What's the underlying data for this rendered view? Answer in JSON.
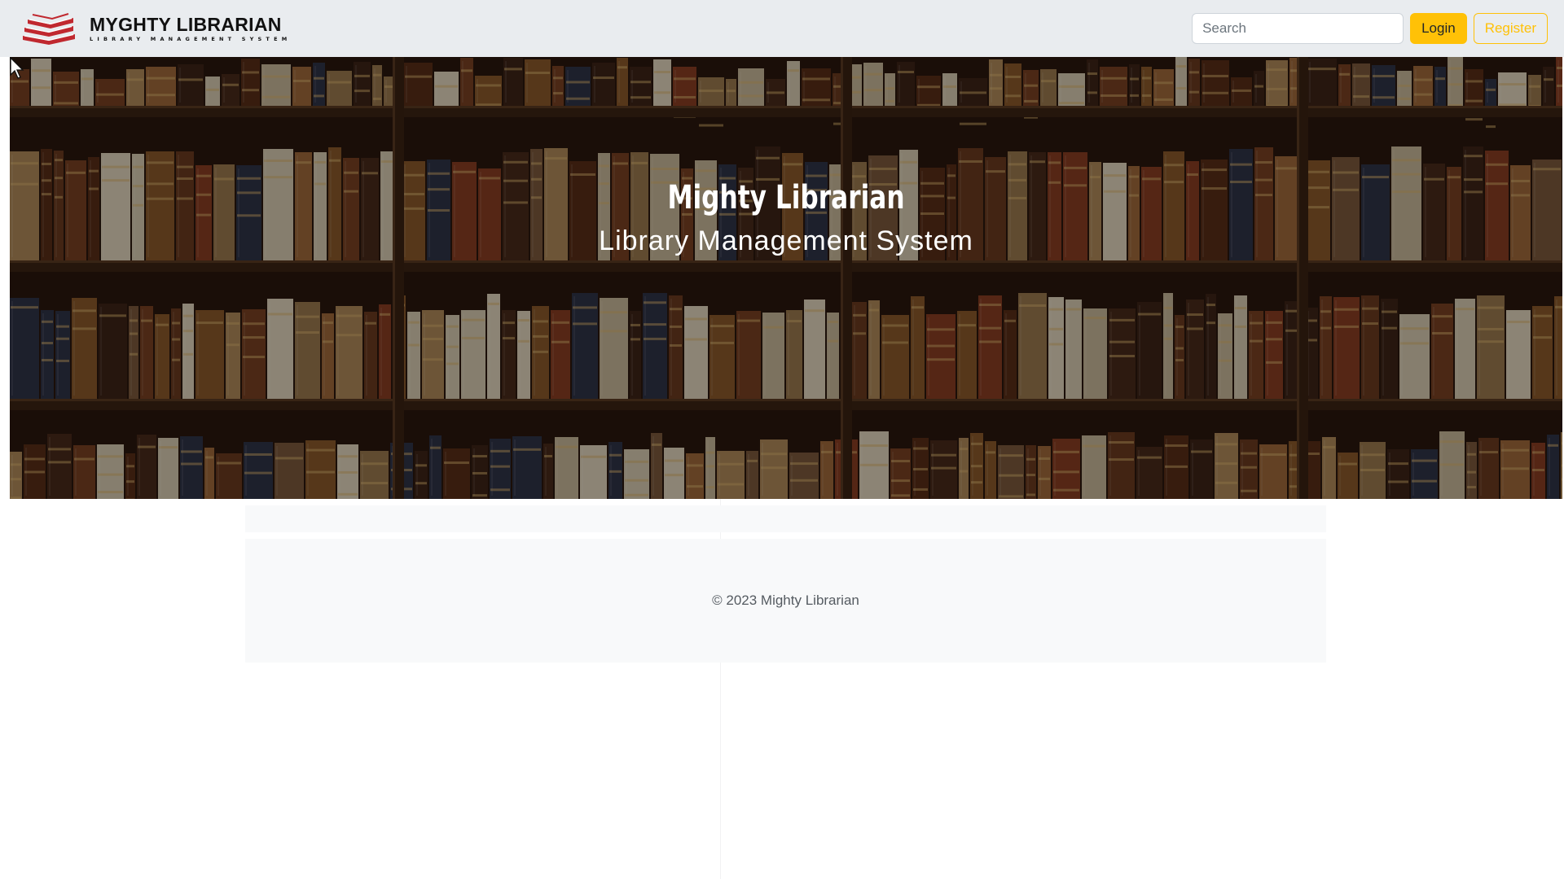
{
  "navbar": {
    "brand_name": "MYGHTY LIBRARIAN",
    "brand_tagline": "LIBRARY MANAGEMENT SYSTEM",
    "logo_icon": "stacked-books-icon",
    "search_placeholder": "Search",
    "search_value": "",
    "login_label": "Login",
    "register_label": "Register"
  },
  "hero": {
    "title": "Mighty Librarian",
    "subtitle": "Library Management System"
  },
  "footer": {
    "text": "© 2023 Mighty Librarian"
  },
  "colors": {
    "navbar_bg": "#e9ecef",
    "accent": "#ffc107",
    "logo_red": "#c0282f",
    "footer_bg": "#f8f9fa"
  }
}
